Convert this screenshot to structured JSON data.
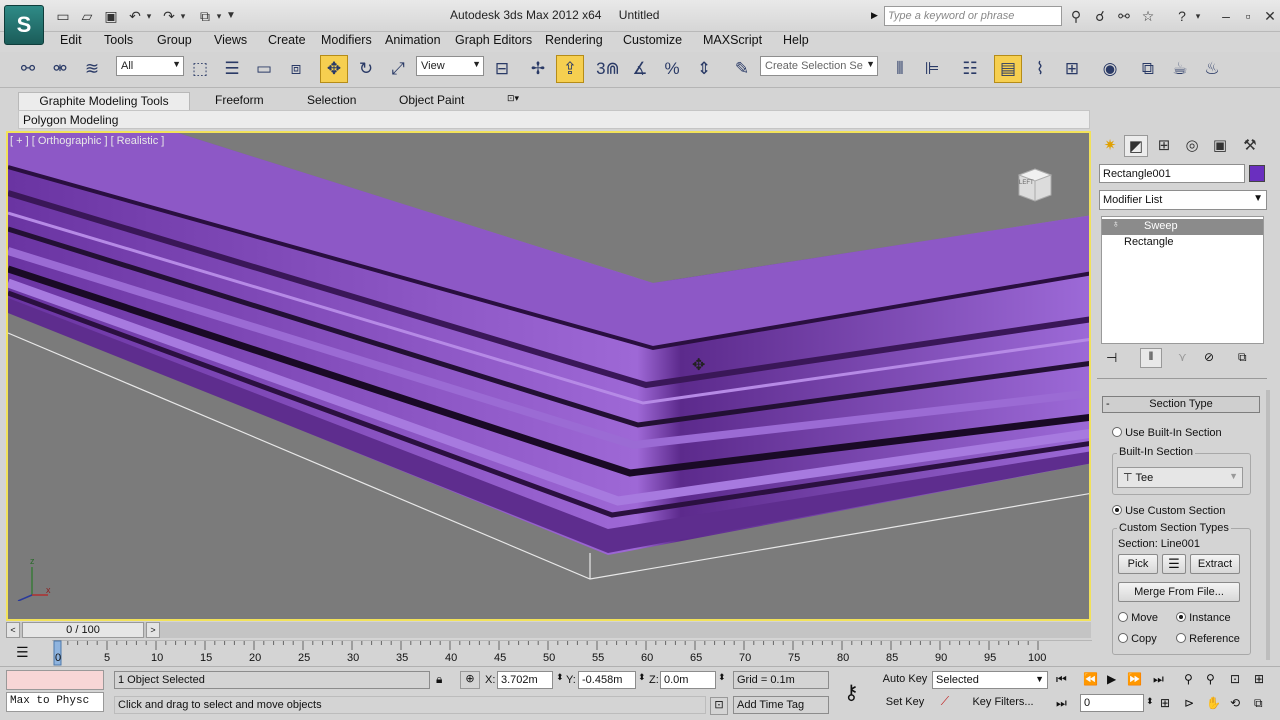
{
  "app": {
    "logo_text": "S",
    "title_product": "Autodesk 3ds Max  2012 x64",
    "title_file": "Untitled",
    "search_placeholder": "Type a keyword or phrase"
  },
  "menu": [
    "Edit",
    "Tools",
    "Group",
    "Views",
    "Create",
    "Modifiers",
    "Animation",
    "Graph Editors",
    "Rendering",
    "Customize",
    "MAXScript",
    "Help"
  ],
  "toolbar": {
    "selection_filter": "All",
    "ref_coord": "View",
    "named_selection_placeholder": "Create Selection Se",
    "snap_label": "3"
  },
  "ribbon": {
    "tabs": [
      "Graphite Modeling Tools",
      "Freeform",
      "Selection",
      "Object Paint"
    ],
    "subtab": "Polygon Modeling"
  },
  "viewport": {
    "label": "[ + ] [ Orthographic ] [ Realistic ]",
    "viewcube_text": "LEFT",
    "axis_z": "z",
    "axis_x": "x",
    "colors": {
      "bg": "#7b7b7b",
      "molding": "#8e55c8",
      "border": "#f2e25a"
    }
  },
  "command_panel": {
    "object_name": "Rectangle001",
    "object_color": "#6a2fbf",
    "modifier_list": "Modifier List",
    "stack": [
      {
        "label": "Sweep",
        "selected": true
      },
      {
        "label": "Rectangle",
        "selected": false
      }
    ],
    "rollout_title": "Section Type",
    "use_builtin": "Use Built-In Section",
    "builtin_group": "Built-In Section",
    "builtin_value": "Tee",
    "use_custom": "Use Custom Section",
    "custom_group": "Custom Section Types",
    "section_label": "Section: Line001",
    "pick": "Pick",
    "extract": "Extract",
    "merge": "Merge From File...",
    "move": "Move",
    "instance": "Instance",
    "copy": "Copy",
    "reference": "Reference"
  },
  "timeline": {
    "frame_label": "0 / 100",
    "ticks": [
      "0",
      "5",
      "10",
      "15",
      "20",
      "25",
      "30",
      "35",
      "40",
      "45",
      "50",
      "55",
      "60",
      "65",
      "70",
      "75",
      "80",
      "85",
      "90",
      "95",
      "100"
    ]
  },
  "status": {
    "script_text": "Max to Physc",
    "selected_text": "1 Object Selected",
    "prompt_text": "Click and drag to select and move objects",
    "x_label": "X:",
    "x_value": "3.702m",
    "y_label": "Y:",
    "y_value": "-0.458m",
    "z_label": "Z:",
    "z_value": "0.0m",
    "grid_text": "Grid = 0.1m",
    "add_time_tag": "Add Time Tag",
    "auto_key": "Auto Key",
    "set_key": "Set Key",
    "key_mode": "Selected",
    "key_filters": "Key Filters...",
    "current_frame": "0"
  }
}
